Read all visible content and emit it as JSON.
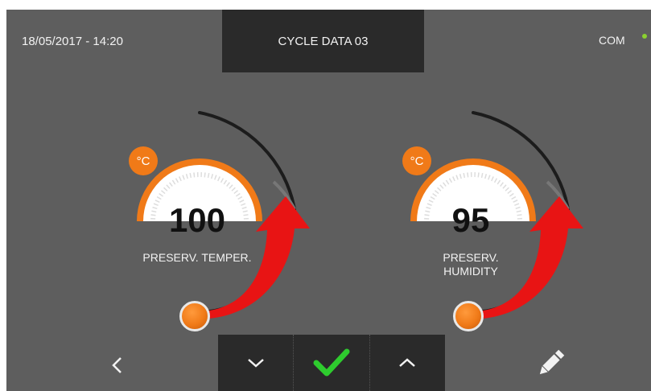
{
  "header": {
    "datetime": "18/05/2017 - 14:20",
    "title": "CYCLE DATA 03",
    "status_label": "COM",
    "status_color": "#8bd12f"
  },
  "gauges": [
    {
      "value": "100",
      "unit": "°C",
      "label_line1": "PRESERV. TEMPER.",
      "label_line2": "",
      "accent": "#f07a18"
    },
    {
      "value": "95",
      "unit": "°C",
      "label_line1": "PRESERV.",
      "label_line2": "HUMIDITY",
      "accent": "#f07a18"
    }
  ],
  "footer": {
    "back_icon": "chevron-left-icon",
    "down_icon": "chevron-down-icon",
    "confirm_icon": "checkmark-icon",
    "up_icon": "chevron-up-icon",
    "edit_icon": "pencil-icon",
    "confirm_color": "#2ecc2e"
  }
}
